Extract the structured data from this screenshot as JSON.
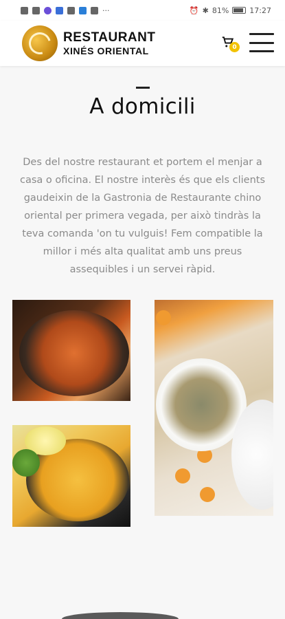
{
  "status_bar": {
    "battery": "81%",
    "time": "17:27",
    "notification_more": "···"
  },
  "header": {
    "logo_line1": "RESTAURANT",
    "logo_line2": "XINÉS ORIENTAL",
    "cart_count": "0"
  },
  "main": {
    "title": "A domicili",
    "intro": "Des del nostre restaurant et portem el menjar a casa o oficina. El nostre interès és que els clients gaudeixin de la Gastronia de Restaurante chino oriental per primera vegada, per això tindràs la teva comanda 'on tu vulguis! Fem compatible la millor i més alta qualitat amb uns preus assequibles i un servei ràpid."
  },
  "colors": {
    "accent": "#f2c200",
    "text_muted": "#8a8a8a",
    "background": "#f7f7f7"
  },
  "gallery": [
    {
      "name": "shrimp-dish-photo"
    },
    {
      "name": "fried-rice-photo"
    },
    {
      "name": "spring-rolls-photo"
    }
  ]
}
